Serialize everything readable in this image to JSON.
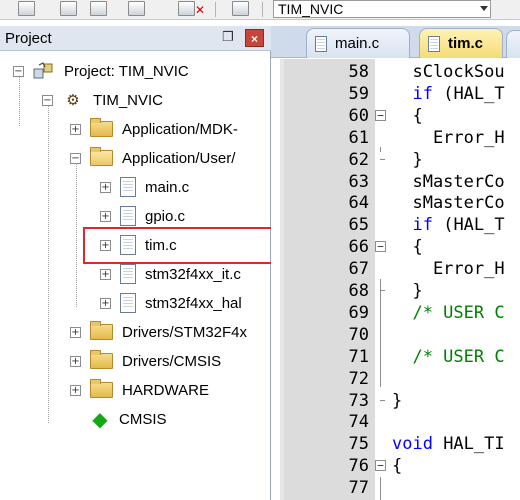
{
  "toolbar": {
    "target_name": "TIM_NVIC"
  },
  "project_panel": {
    "title": "Project",
    "pin_glyph": "❒",
    "close_glyph": "×",
    "tree": [
      {
        "label": "Project: TIM_NVIC",
        "icon": "project-icon",
        "expander": "−"
      },
      {
        "label": "TIM_NVIC",
        "icon": "target-icon",
        "expander": "−"
      },
      {
        "label": "Application/MDK-",
        "icon": "folder-icon",
        "expander": "+"
      },
      {
        "label": "Application/User/",
        "icon": "folder-open-icon",
        "expander": "−"
      },
      {
        "label": "main.c",
        "icon": "file-icon",
        "expander": "+"
      },
      {
        "label": "gpio.c",
        "icon": "file-icon",
        "expander": "+"
      },
      {
        "label": "tim.c",
        "icon": "file-icon",
        "expander": "+"
      },
      {
        "label": "stm32f4xx_it.c",
        "icon": "file-icon",
        "expander": "+"
      },
      {
        "label": "stm32f4xx_hal",
        "icon": "file-icon",
        "expander": "+"
      },
      {
        "label": "Drivers/STM32F4x",
        "icon": "folder-icon",
        "expander": "+"
      },
      {
        "label": "Drivers/CMSIS",
        "icon": "folder-icon",
        "expander": "+"
      },
      {
        "label": "HARDWARE",
        "icon": "folder-icon",
        "expander": "+"
      },
      {
        "label": "CMSIS",
        "icon": "cmsis-diamond-icon",
        "expander": ""
      }
    ]
  },
  "editor": {
    "tabs": [
      {
        "label": "main.c",
        "active": false
      },
      {
        "label": "tim.c",
        "active": true
      }
    ],
    "lines": [
      {
        "num": "58",
        "fold": "",
        "parts": [
          {
            "t": "  sClockSou",
            "c": ""
          }
        ]
      },
      {
        "num": "59",
        "fold": "",
        "parts": [
          {
            "t": "  ",
            "c": ""
          },
          {
            "t": "if",
            "c": "kw"
          },
          {
            "t": " (HAL_T",
            "c": ""
          }
        ]
      },
      {
        "num": "60",
        "fold": "−",
        "parts": [
          {
            "t": "  {",
            "c": ""
          }
        ]
      },
      {
        "num": "61",
        "fold": "",
        "parts": [
          {
            "t": "    Error_H",
            "c": ""
          }
        ]
      },
      {
        "num": "62",
        "fold": "end",
        "parts": [
          {
            "t": "  }",
            "c": ""
          }
        ]
      },
      {
        "num": "63",
        "fold": "",
        "parts": [
          {
            "t": "  sMasterCo",
            "c": ""
          }
        ]
      },
      {
        "num": "64",
        "fold": "",
        "parts": [
          {
            "t": "  sMasterCo",
            "c": ""
          }
        ]
      },
      {
        "num": "65",
        "fold": "",
        "parts": [
          {
            "t": "  ",
            "c": ""
          },
          {
            "t": "if",
            "c": "kw"
          },
          {
            "t": " (HAL_T",
            "c": ""
          }
        ]
      },
      {
        "num": "66",
        "fold": "−",
        "parts": [
          {
            "t": "  {",
            "c": ""
          }
        ]
      },
      {
        "num": "67",
        "fold": "",
        "parts": [
          {
            "t": "    Error_H",
            "c": ""
          }
        ]
      },
      {
        "num": "68",
        "fold": "end",
        "parts": [
          {
            "t": "  }",
            "c": ""
          }
        ]
      },
      {
        "num": "69",
        "fold": "",
        "parts": [
          {
            "t": "  /* USER C",
            "c": "cm"
          }
        ]
      },
      {
        "num": "70",
        "fold": "",
        "parts": [
          {
            "t": "",
            "c": ""
          }
        ]
      },
      {
        "num": "71",
        "fold": "",
        "parts": [
          {
            "t": "  /* USER C",
            "c": "cm"
          }
        ]
      },
      {
        "num": "72",
        "fold": "",
        "parts": [
          {
            "t": "",
            "c": ""
          }
        ]
      },
      {
        "num": "73",
        "fold": "end",
        "parts": [
          {
            "t": "}",
            "c": ""
          }
        ]
      },
      {
        "num": "74",
        "fold": "",
        "parts": [
          {
            "t": "",
            "c": ""
          }
        ]
      },
      {
        "num": "75",
        "fold": "",
        "parts": [
          {
            "t": "void",
            "c": "kw"
          },
          {
            "t": " HAL_TI",
            "c": ""
          }
        ]
      },
      {
        "num": "76",
        "fold": "−",
        "parts": [
          {
            "t": "{",
            "c": ""
          }
        ]
      },
      {
        "num": "77",
        "fold": "",
        "parts": [
          {
            "t": "",
            "c": ""
          }
        ]
      }
    ]
  }
}
